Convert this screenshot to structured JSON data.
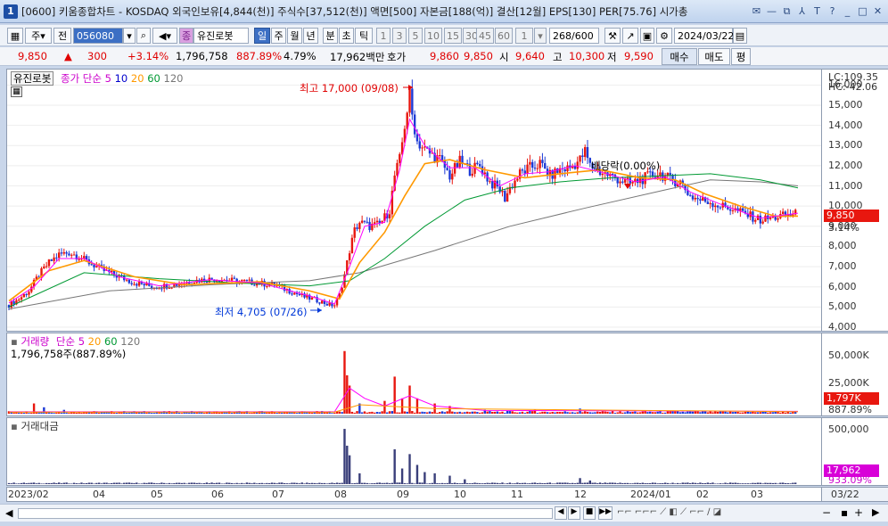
{
  "window": {
    "badge": "1",
    "title": "[0600] 키움종합차트 - KOSDAQ 외국인보유[4,844(천)] 주식수[37,512(천)] 액면[500] 자본금[188(억)] 결산[12월] EPS[130] PER[75.76] 시가총",
    "buttons": [
      "✉",
      "—",
      "⧉",
      "⅄",
      "T",
      "?",
      "_",
      "□",
      "✕"
    ]
  },
  "toolbar": {
    "main_dropdown": "주",
    "period_label": "전",
    "stock_code": "056080",
    "stock_type_badge": "종",
    "stock_name": "유진로봇",
    "period_buttons": [
      "일",
      "주",
      "월",
      "년",
      "분",
      "초",
      "틱"
    ],
    "active_period": "일",
    "interval_buttons": [
      "1",
      "3",
      "5",
      "10",
      "15",
      "30",
      "45",
      "60"
    ],
    "interval_value": "1",
    "count": "268/600",
    "date": "2024/03/22"
  },
  "quote": {
    "price": "9,850",
    "change": "300",
    "change_rate": "+3.14%",
    "volume": "1,796,758",
    "volume_ratio": "887.89%",
    "turnover": "4.79%",
    "amount": "17,962백만",
    "ask_label": "호가",
    "ask": "9,860",
    "bid": "9,850",
    "open_label": "시",
    "open": "9,640",
    "high_label": "고",
    "high": "10,300",
    "low_label": "저",
    "low": "9,590",
    "buy_btn": "매수",
    "sell_btn": "매도",
    "eval_btn": "평"
  },
  "price_panel": {
    "stock_tag": "유진로봇",
    "ma_title": "종가 단순",
    "ma_periods": [
      "5",
      "10",
      "20",
      "60",
      "120"
    ],
    "ma_colors": [
      "#ff00ff",
      "#0000cc",
      "#ff9900",
      "#009933",
      "#777777"
    ],
    "lc": "LC:109.35",
    "hc": "HC:-42.06",
    "annot_high": "최고 17,000 (09/08)",
    "annot_low": "최저 4,705 (07/26)",
    "annot_dividend": "배당락(0.00%)",
    "current_label": "9,850",
    "current_rate": "3.14%"
  },
  "volume_panel": {
    "title": "거래량",
    "ma_title": "단순",
    "ma_periods": [
      "5",
      "20",
      "60",
      "120"
    ],
    "value": "1,796,758주(887.89%)",
    "current_label": "1,797K",
    "current_rate": "887.89%"
  },
  "amount_panel": {
    "title": "거래대금",
    "current_label": "17,962",
    "current_rate": "933.09%"
  },
  "chart_data": {
    "type": "candlestick",
    "x_labels": [
      "2023/02",
      "04",
      "05",
      "06",
      "07",
      "08",
      "09",
      "10",
      "11",
      "12",
      "2024/01",
      "02",
      "03",
      "03/22"
    ],
    "price_ticks": [
      "16,000",
      "15,000",
      "14,000",
      "13,000",
      "12,000",
      "11,000",
      "10,000",
      "9,000",
      "8,000",
      "7,000",
      "6,000",
      "5,000",
      "4,000"
    ],
    "price_ylim": [
      4000,
      16500
    ],
    "volume_ticks": [
      "50,000K",
      "25,000K"
    ],
    "volume_ylim": [
      0,
      60000
    ],
    "amount_ticks": [
      "500,000"
    ],
    "amount_ylim": [
      0,
      520000
    ],
    "close_path": [
      [
        0,
        5100
      ],
      [
        4,
        5400
      ],
      [
        8,
        5800
      ],
      [
        12,
        6600
      ],
      [
        16,
        7200
      ],
      [
        20,
        7600
      ],
      [
        24,
        7700
      ],
      [
        28,
        7500
      ],
      [
        32,
        7200
      ],
      [
        38,
        6800
      ],
      [
        44,
        6500
      ],
      [
        50,
        6200
      ],
      [
        58,
        6000
      ],
      [
        66,
        6100
      ],
      [
        74,
        6300
      ],
      [
        82,
        6400
      ],
      [
        90,
        6300
      ],
      [
        98,
        6200
      ],
      [
        106,
        6100
      ],
      [
        112,
        5800
      ],
      [
        118,
        5500
      ],
      [
        124,
        5300
      ],
      [
        128,
        5100
      ],
      [
        130,
        5100
      ],
      [
        132,
        5600
      ],
      [
        134,
        6600
      ],
      [
        136,
        7800
      ],
      [
        138,
        8800
      ],
      [
        140,
        9200
      ],
      [
        144,
        9000
      ],
      [
        148,
        9100
      ],
      [
        152,
        9800
      ],
      [
        154,
        11500
      ],
      [
        156,
        12300
      ],
      [
        158,
        14000
      ],
      [
        160,
        15500
      ],
      [
        161,
        14500
      ],
      [
        163,
        13200
      ],
      [
        166,
        12800
      ],
      [
        168,
        12600
      ],
      [
        172,
        12300
      ],
      [
        176,
        11500
      ],
      [
        180,
        12200
      ],
      [
        184,
        11800
      ],
      [
        188,
        12000
      ],
      [
        192,
        11200
      ],
      [
        196,
        10800
      ],
      [
        198,
        10400
      ],
      [
        200,
        10900
      ],
      [
        204,
        11600
      ],
      [
        208,
        11900
      ],
      [
        212,
        12100
      ],
      [
        216,
        11500
      ],
      [
        220,
        11800
      ],
      [
        224,
        11900
      ],
      [
        228,
        12300
      ],
      [
        230,
        12700
      ],
      [
        232,
        12000
      ],
      [
        236,
        11700
      ],
      [
        240,
        11500
      ],
      [
        244,
        11300
      ],
      [
        248,
        11100
      ],
      [
        252,
        11300
      ],
      [
        256,
        11500
      ],
      [
        260,
        11600
      ],
      [
        264,
        11300
      ],
      [
        268,
        11200
      ],
      [
        272,
        10500
      ],
      [
        276,
        10300
      ],
      [
        280,
        10200
      ],
      [
        284,
        10000
      ],
      [
        288,
        9900
      ],
      [
        292,
        9700
      ],
      [
        296,
        9500
      ],
      [
        300,
        9300
      ],
      [
        304,
        9400
      ],
      [
        308,
        9500
      ],
      [
        312,
        9550
      ],
      [
        315,
        9850
      ]
    ],
    "ma5_path": [
      [
        0,
        5200
      ],
      [
        10,
        6000
      ],
      [
        20,
        7400
      ],
      [
        30,
        7400
      ],
      [
        44,
        6500
      ],
      [
        60,
        6050
      ],
      [
        80,
        6350
      ],
      [
        100,
        6200
      ],
      [
        120,
        5550
      ],
      [
        130,
        5150
      ],
      [
        136,
        7000
      ],
      [
        142,
        9000
      ],
      [
        150,
        9200
      ],
      [
        156,
        11800
      ],
      [
        160,
        14300
      ],
      [
        166,
        13000
      ],
      [
        176,
        11900
      ],
      [
        186,
        11900
      ],
      [
        196,
        11000
      ],
      [
        206,
        11600
      ],
      [
        216,
        11700
      ],
      [
        226,
        12000
      ],
      [
        236,
        11700
      ],
      [
        250,
        11200
      ],
      [
        262,
        11450
      ],
      [
        272,
        10700
      ],
      [
        286,
        10000
      ],
      [
        300,
        9400
      ],
      [
        315,
        9650
      ]
    ],
    "ma20_path": [
      [
        0,
        5300
      ],
      [
        16,
        6800
      ],
      [
        30,
        7300
      ],
      [
        50,
        6500
      ],
      [
        70,
        6100
      ],
      [
        100,
        6250
      ],
      [
        120,
        5800
      ],
      [
        132,
        5400
      ],
      [
        140,
        7200
      ],
      [
        150,
        8700
      ],
      [
        158,
        10500
      ],
      [
        166,
        12100
      ],
      [
        176,
        12300
      ],
      [
        190,
        11800
      ],
      [
        206,
        11400
      ],
      [
        220,
        11600
      ],
      [
        236,
        11800
      ],
      [
        252,
        11400
      ],
      [
        266,
        11300
      ],
      [
        278,
        10600
      ],
      [
        292,
        10000
      ],
      [
        306,
        9500
      ],
      [
        315,
        9500
      ]
    ],
    "ma60_path": [
      [
        0,
        5000
      ],
      [
        30,
        6700
      ],
      [
        60,
        6400
      ],
      [
        90,
        6200
      ],
      [
        120,
        6050
      ],
      [
        136,
        6300
      ],
      [
        150,
        7400
      ],
      [
        166,
        9000
      ],
      [
        182,
        10300
      ],
      [
        200,
        10900
      ],
      [
        220,
        11200
      ],
      [
        240,
        11400
      ],
      [
        260,
        11500
      ],
      [
        280,
        11600
      ],
      [
        300,
        11300
      ],
      [
        315,
        10900
      ]
    ],
    "ma120_path": [
      [
        0,
        4900
      ],
      [
        40,
        5800
      ],
      [
        80,
        6100
      ],
      [
        120,
        6300
      ],
      [
        140,
        6700
      ],
      [
        170,
        7800
      ],
      [
        200,
        9000
      ],
      [
        230,
        9900
      ],
      [
        262,
        10800
      ],
      [
        280,
        11300
      ],
      [
        300,
        11200
      ],
      [
        315,
        11000
      ]
    ],
    "volume_spikes": [
      [
        10,
        8000
      ],
      [
        14,
        5000
      ],
      [
        22,
        3000
      ],
      [
        134,
        49000
      ],
      [
        135,
        30000
      ],
      [
        136,
        22000
      ],
      [
        140,
        8000
      ],
      [
        150,
        10000
      ],
      [
        154,
        29000
      ],
      [
        157,
        12000
      ],
      [
        160,
        22000
      ],
      [
        163,
        12000
      ],
      [
        170,
        8000
      ],
      [
        176,
        6000
      ],
      [
        190,
        3000
      ],
      [
        210,
        3000
      ],
      [
        228,
        4000
      ]
    ],
    "amount_spikes": [
      [
        134,
        460000
      ],
      [
        135,
        320000
      ],
      [
        136,
        240000
      ],
      [
        140,
        90000
      ],
      [
        154,
        290000
      ],
      [
        157,
        130000
      ],
      [
        160,
        250000
      ],
      [
        163,
        160000
      ],
      [
        166,
        100000
      ],
      [
        170,
        90000
      ],
      [
        176,
        70000
      ],
      [
        182,
        40000
      ],
      [
        228,
        50000
      ],
      [
        232,
        30000
      ]
    ]
  }
}
